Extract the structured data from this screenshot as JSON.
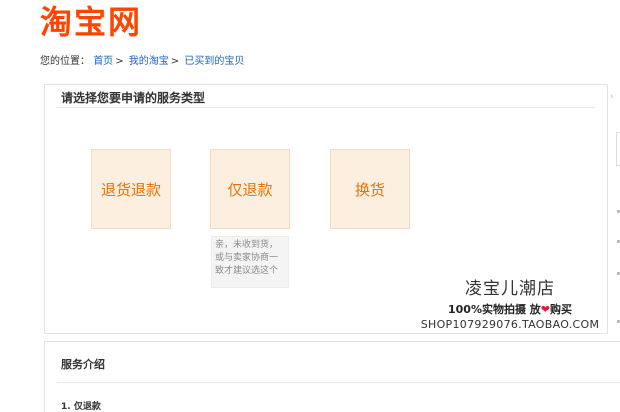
{
  "header": {
    "logo_text": "淘宝网",
    "brand_color": "#ff4400"
  },
  "breadcrumb": {
    "prefix": "您的位置：",
    "items": [
      "首页",
      "我的淘宝",
      "已买到的宝贝"
    ],
    "separator": ">"
  },
  "service_panel": {
    "title": "请选择您要申请的服务类型",
    "options": [
      {
        "label": "退货退款"
      },
      {
        "label": "仅退款"
      },
      {
        "label": "换货"
      }
    ],
    "tooltip": "亲，未收到货，或与卖家协商一致才建议选这个",
    "accent_color": "#e8710a",
    "tile_color": "#fcefdf"
  },
  "watermark": {
    "shop_name": "凌宝儿潮店",
    "slogan_before": "100%实物拍摄 放",
    "slogan_heart": "❤",
    "slogan_after": "购买",
    "url": "SHOP107929076.TAOBAO.COM"
  },
  "intro": {
    "title": "服务介绍",
    "item_1": "1. 仅退款"
  }
}
